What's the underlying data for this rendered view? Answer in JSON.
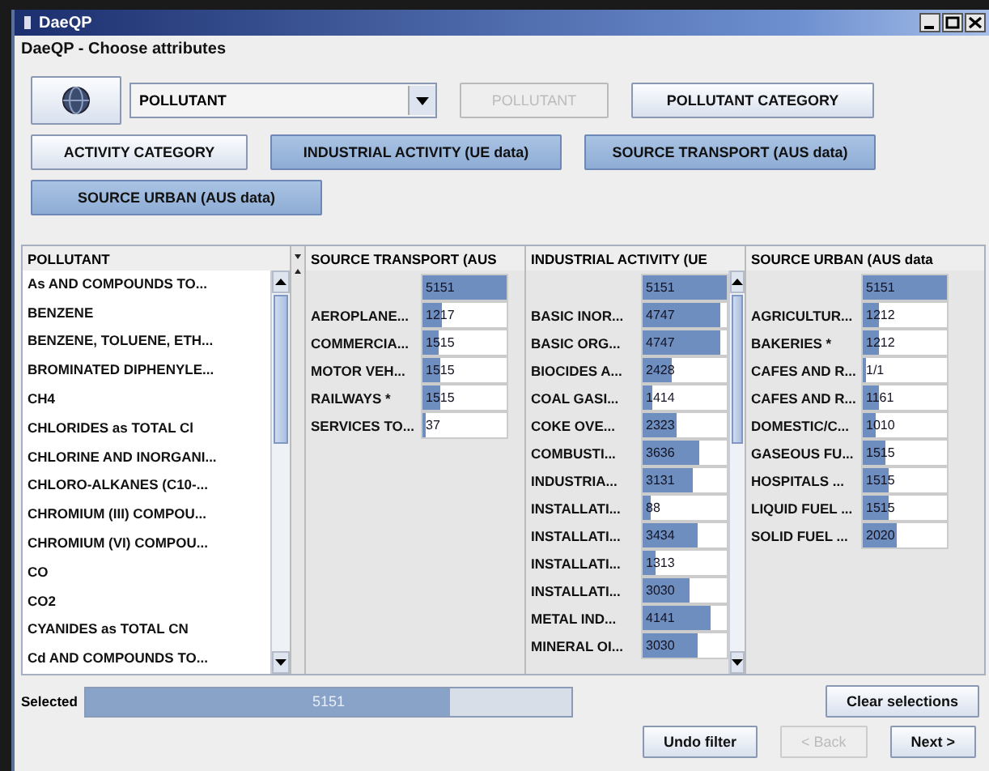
{
  "window": {
    "title": "DaeQP"
  },
  "subtitle": "DaeQP - Choose attributes",
  "attribute_combo": {
    "value": "POLLUTANT"
  },
  "attribute_buttons": [
    {
      "label": "POLLUTANT",
      "selected": false,
      "disabled": true
    },
    {
      "label": "POLLUTANT CATEGORY",
      "selected": false,
      "disabled": false
    },
    {
      "label": "ACTIVITY CATEGORY",
      "selected": false,
      "disabled": false
    },
    {
      "label": "INDUSTRIAL ACTIVITY (UE data)",
      "selected": true,
      "disabled": false
    },
    {
      "label": "SOURCE TRANSPORT (AUS data)",
      "selected": true,
      "disabled": false
    },
    {
      "label": "SOURCE URBAN (AUS data)",
      "selected": true,
      "disabled": false
    }
  ],
  "pollutant_list": {
    "header": "POLLUTANT",
    "items": [
      "As AND COMPOUNDS TO...",
      "BENZENE",
      "BENZENE, TOLUENE, ETH...",
      "BROMINATED DIPHENYLE...",
      "CH4",
      "CHLORIDES as TOTAL Cl",
      "CHLORINE AND INORGANI...",
      "CHLORO-ALKANES (C10-...",
      "CHROMIUM (III) COMPOU...",
      "CHROMIUM (VI) COMPOU...",
      "CO",
      "CO2",
      "CYANIDES as TOTAL CN",
      "Cd AND COMPOUNDS TO..."
    ]
  },
  "attribute_columns": [
    {
      "header": "SOURCE TRANSPORT (AUS",
      "total": "5151",
      "level": 1,
      "scrollbar": false,
      "rows": [
        {
          "label": "AEROPLANE...",
          "value": "1217",
          "level": 0.24
        },
        {
          "label": "COMMERCIA...",
          "value": "1515",
          "level": 0.2
        },
        {
          "label": "MOTOR VEH...",
          "value": "1515",
          "level": 0.22
        },
        {
          "label": "RAILWAYS *",
          "value": "1515",
          "level": 0.22
        },
        {
          "label": "SERVICES TO...",
          "value": "37",
          "level": 0.04
        }
      ]
    },
    {
      "header": "INDUSTRIAL ACTIVITY (UE",
      "total": "5151",
      "level": 1,
      "scrollbar": true,
      "rows": [
        {
          "label": "BASIC INOR...",
          "value": "4747",
          "level": 0.92
        },
        {
          "label": "BASIC ORG...",
          "value": "4747",
          "level": 0.92
        },
        {
          "label": "BIOCIDES A...",
          "value": "2428",
          "level": 0.35
        },
        {
          "label": "COAL GASI...",
          "value": "1414",
          "level": 0.12
        },
        {
          "label": "COKE OVE...",
          "value": "2323",
          "level": 0.4
        },
        {
          "label": "COMBUSTI...",
          "value": "3636",
          "level": 0.68
        },
        {
          "label": "INDUSTRIA...",
          "value": "3131",
          "level": 0.6
        },
        {
          "label": "INSTALLATI...",
          "value": "88",
          "level": 0.1
        },
        {
          "label": "INSTALLATI...",
          "value": "3434",
          "level": 0.65
        },
        {
          "label": "INSTALLATI...",
          "value": "1313",
          "level": 0.15
        },
        {
          "label": "INSTALLATI...",
          "value": "3030",
          "level": 0.55
        },
        {
          "label": "METAL IND...",
          "value": "4141",
          "level": 0.8
        },
        {
          "label": "MINERAL OI...",
          "value": "3030",
          "level": 0.65
        }
      ]
    },
    {
      "header": "SOURCE URBAN (AUS data",
      "total": "5151",
      "level": 1,
      "scrollbar": false,
      "rows": [
        {
          "label": "AGRICULTUR...",
          "value": "1212",
          "level": 0.2
        },
        {
          "label": "BAKERIES *",
          "value": "1212",
          "level": 0.2
        },
        {
          "label": "CAFES AND R...",
          "value": "1/1",
          "level": 0.03
        },
        {
          "label": "CAFES AND R...",
          "value": "1161",
          "level": 0.2
        },
        {
          "label": "DOMESTIC/C...",
          "value": "1010",
          "level": 0.15
        },
        {
          "label": "GASEOUS FU...",
          "value": "1515",
          "level": 0.26
        },
        {
          "label": "HOSPITALS ...",
          "value": "1515",
          "level": 0.3
        },
        {
          "label": "LIQUID FUEL ...",
          "value": "1515",
          "level": 0.3
        },
        {
          "label": "SOLID FUEL ...",
          "value": "2020",
          "level": 0.4
        }
      ]
    }
  ],
  "selected_bar": {
    "label": "Selected",
    "value": "5151",
    "level": 0.75
  },
  "buttons": [
    {
      "label": "Clear selections",
      "disabled": false
    },
    {
      "label": "Undo filter",
      "disabled": false
    },
    {
      "label": "< Back",
      "disabled": true
    },
    {
      "label": "Next >",
      "disabled": false
    }
  ]
}
